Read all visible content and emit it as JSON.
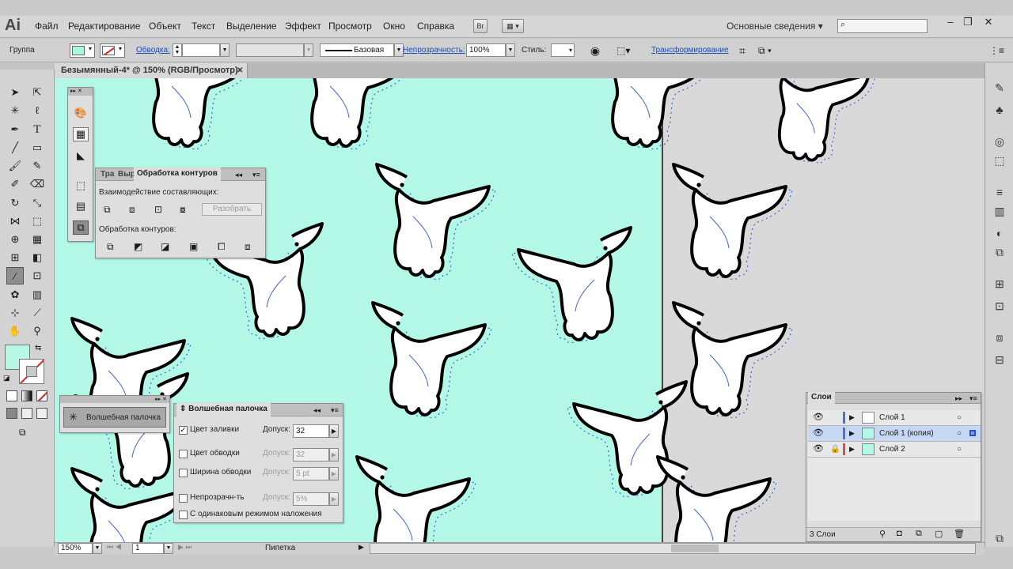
{
  "app": {
    "logo": "Ai",
    "menus": [
      "Файл",
      "Редактирование",
      "Объект",
      "Текст",
      "Выделение",
      "Эффект",
      "Просмотр",
      "Окно",
      "Справка"
    ],
    "br_label": "Br",
    "workspace": "Основные сведения",
    "window_controls": [
      "–",
      "❐",
      "✕"
    ]
  },
  "control_bar": {
    "selection_type": "Группа",
    "stroke_link": "Обводка:",
    "brush_label": "Базовая",
    "opacity_link": "Непрозрачность:",
    "opacity_value": "100%",
    "styles_label": "Стиль:",
    "transform_link": "Трансформирование",
    "fill_color": "#aaf6e4"
  },
  "document": {
    "tab_title": "Безымянный-4* @ 150% (RGB/Просмотр)",
    "tab_close": "✕"
  },
  "pathfinder": {
    "tabs": [
      "Тра",
      "Выр",
      "Обработка контуров"
    ],
    "shape_modes_label": "Взаимодействие составляющих:",
    "expand_button": "Разобрать",
    "pathfinders_label": "Обработка контуров:"
  },
  "magic_wand_tool": {
    "label": "Волшебная палочка"
  },
  "magic_wand_panel": {
    "title": "Волшебная палочка",
    "tolerance_label": "Допуск:",
    "rows": [
      {
        "label": "Цвет заливки",
        "checked": true,
        "value": "32",
        "enabled": true
      },
      {
        "label": "Цвет обводки",
        "checked": false,
        "value": "32",
        "enabled": false
      },
      {
        "label": "Ширина обводки",
        "checked": false,
        "value": "5 pt",
        "enabled": false
      },
      {
        "label": "Непрозрачн-ть",
        "checked": false,
        "value": "5%",
        "enabled": false
      }
    ],
    "blend_label": "С одинаковым режимом наложения"
  },
  "layers": {
    "title": "Слои",
    "items": [
      {
        "name": "Слой 1",
        "color": "#4f6fd8",
        "locked": false
      },
      {
        "name": "Слой 1 (копия)",
        "color": "#4f6fd8",
        "locked": false
      },
      {
        "name": "Слой 2",
        "color": "#d84f4f",
        "locked": true
      }
    ],
    "count": "3 Слои"
  },
  "status": {
    "zoom": "150%",
    "artboard": "1",
    "tool": "Пипетка"
  },
  "colors": {
    "artboard_bg": "#b3f7e6",
    "path_highlight": "#3d63d6"
  }
}
